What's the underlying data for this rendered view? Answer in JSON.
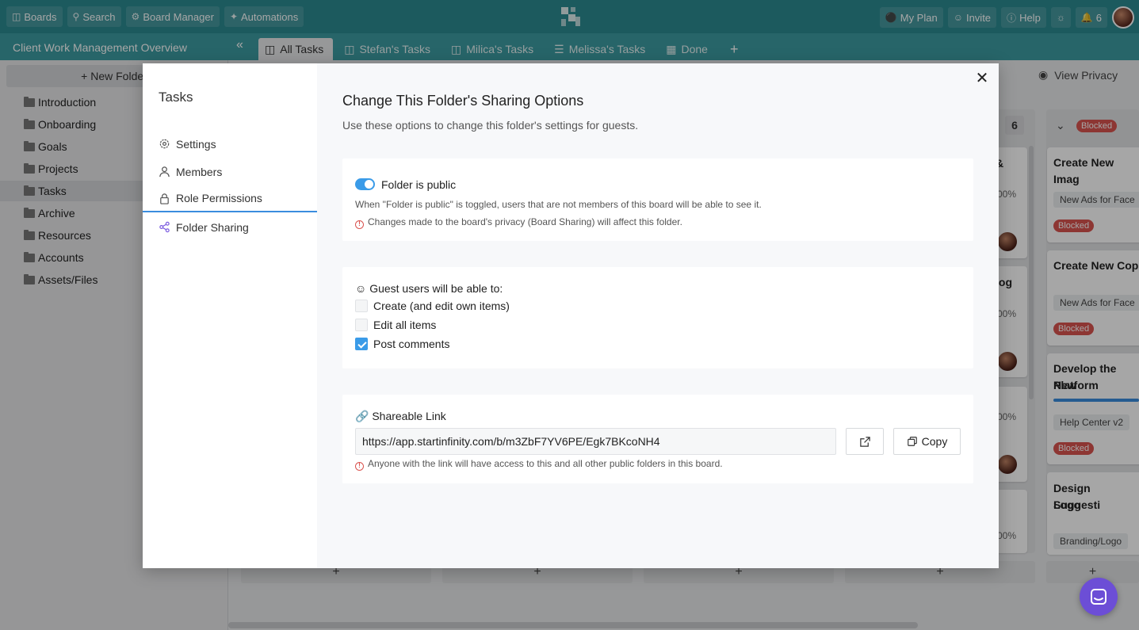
{
  "topbar": {
    "boards": "Boards",
    "search": "Search",
    "board_manager": "Board Manager",
    "automations": "Automations",
    "my_plan": "My Plan",
    "invite": "Invite",
    "help": "Help",
    "notifications_count": "6"
  },
  "subbar": {
    "title": "Client Work Management Overview",
    "tabs": [
      {
        "label": "All Tasks",
        "icon": "board-icon"
      },
      {
        "label": "Stefan's Tasks",
        "icon": "board-icon"
      },
      {
        "label": "Milica's Tasks",
        "icon": "board-icon"
      },
      {
        "label": "Melissa's Tasks",
        "icon": "list-icon"
      },
      {
        "label": "Done",
        "icon": "table-icon"
      }
    ],
    "add_tab": "+"
  },
  "sidebar": {
    "new_folder": "+ New Folder",
    "folders": [
      "Introduction",
      "Onboarding",
      "Goals",
      "Projects",
      "Tasks",
      "Archive",
      "Resources",
      "Accounts",
      "Assets/Files"
    ],
    "active": "Tasks"
  },
  "board": {
    "view_privacy": "View Privacy",
    "col_count": "6",
    "blocked": "Blocked",
    "cards_right": [
      {
        "title": "Create New Imag",
        "tag": "New Ads for Face",
        "status": "Blocked"
      },
      {
        "title": "Create New Cop",
        "tag": "New Ads for Face",
        "status": "Blocked"
      },
      {
        "title": "Develop the New",
        "title2": "Platform",
        "tag": "Help Center v2",
        "status": "Blocked"
      },
      {
        "title": "Design Suggesti",
        "title2": "Logo",
        "tag": "Branding/Logo"
      }
    ],
    "mid_snippets": [
      "&",
      "00%",
      "log",
      "00%",
      "00%",
      "00%"
    ],
    "add": "+"
  },
  "modal": {
    "left_title": "Tasks",
    "nav": [
      {
        "label": "Settings",
        "icon": "gear-icon"
      },
      {
        "label": "Members",
        "icon": "user-icon"
      },
      {
        "label": "Role Permissions",
        "icon": "lock-icon"
      },
      {
        "label": "Folder Sharing",
        "icon": "share-icon"
      }
    ],
    "active_nav": "Folder Sharing",
    "title": "Change This Folder's Sharing Options",
    "subtitle": "Use these options to change this folder's settings for guests.",
    "public": {
      "label": "Folder is public",
      "enabled": true,
      "help": "When \"Folder is public\" is toggled, users that are not members of this board will be able to see it.",
      "warning": "Changes made to the board's privacy (Board Sharing) will affect this folder."
    },
    "guests": {
      "heading": "Guest users will be able to:",
      "options": [
        {
          "label": "Create (and edit own items)",
          "checked": false
        },
        {
          "label": "Edit all items",
          "checked": false
        },
        {
          "label": "Post comments",
          "checked": true
        }
      ]
    },
    "share": {
      "heading": "Shareable Link",
      "url": "https://app.startinfinity.com/b/m3ZbF7YV6PE/Egk7BKcoNH4",
      "copy": "Copy",
      "warning": "Anyone with the link will have access to this and all other public folders in this board."
    }
  },
  "colors": {
    "topbar": "#2b8a91",
    "accent": "#3a9be8",
    "blocked": "#d9534f",
    "chat": "#6c4ed6"
  }
}
